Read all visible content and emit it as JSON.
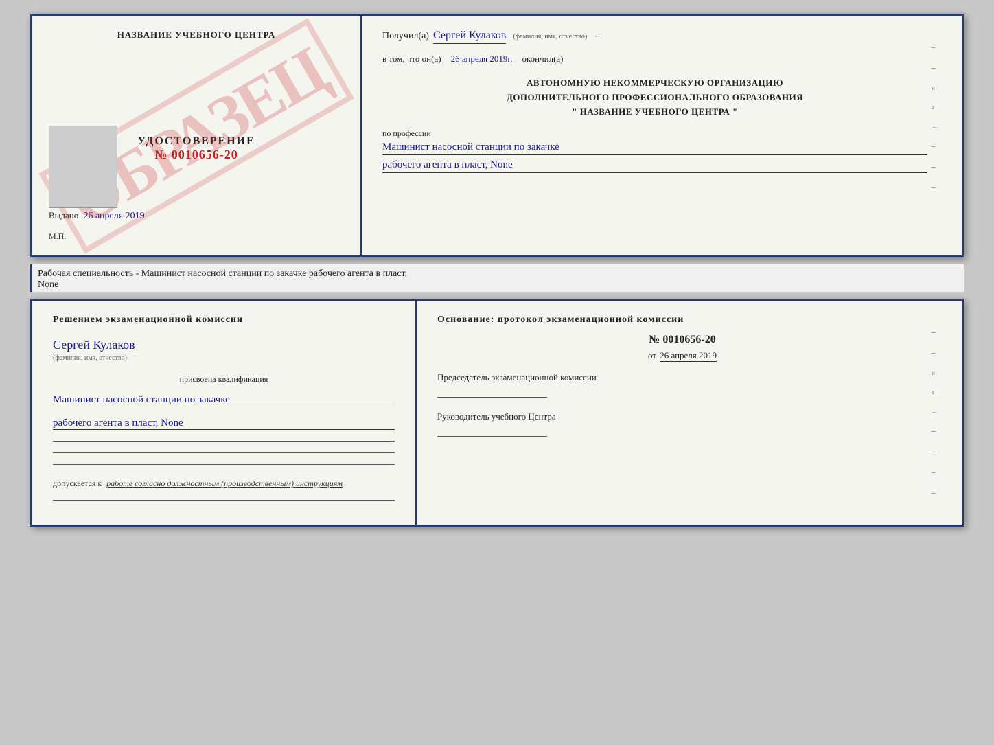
{
  "top_document": {
    "left": {
      "center_title": "НАЗВАНИЕ УЧЕБНОГО ЦЕНТРА",
      "watermark": "ОБРАЗЕЦ",
      "udostoverenie": {
        "label": "УДОСТОВЕРЕНИЕ",
        "number": "№ 0010656-20"
      },
      "vydano": "Выдано",
      "vydano_date": "26 апреля 2019",
      "mp": "М.П."
    },
    "right": {
      "poluchil_label": "Получил(а)",
      "poluchil_name": "Сергей Кулаков",
      "poluchil_sub": "(фамилия, имя, отчество)",
      "dash": "–",
      "vtom_label": "в том, что он(а)",
      "vtom_date": "26 апреля 2019г.",
      "okonchil": "окончил(а)",
      "org_line1": "АВТОНОМНУЮ НЕКОММЕРЧЕСКУЮ ОРГАНИЗАЦИЮ",
      "org_line2": "ДОПОЛНИТЕЛЬНОГО ПРОФЕССИОНАЛЬНОГО ОБРАЗОВАНИЯ",
      "org_line3": "\" НАЗВАНИЕ УЧЕБНОГО ЦЕНТРА \"",
      "po_professii": "по профессии",
      "profession1": "Машинист насосной станции по закачке",
      "profession2": "рабочего агента в пласт, None",
      "side_marks": [
        "и",
        "а",
        "←",
        "–",
        "–",
        "–",
        "–"
      ]
    }
  },
  "subtitle": {
    "line1": "Рабочая специальность - Машинист насосной станции по закачке рабочего агента в пласт,",
    "line2": "None"
  },
  "bottom_document": {
    "left": {
      "resheniyem": "Решением экзаменационной комиссии",
      "name": "Сергей Кулаков",
      "name_sub": "(фамилия, имя, отчество)",
      "prisvoena": "присвоена квалификация",
      "qual1": "Машинист насосной станции по закачке",
      "qual2": "рабочего агента в пласт, None",
      "underlines": [
        "",
        "",
        ""
      ],
      "dopuskaetsya_label": "допускается к",
      "dopuskaetsya_val": "работе согласно должностным (производственным) инструкциям",
      "underline_final": ""
    },
    "right": {
      "osnovanie": "Основание: протокол экзаменационной комиссии",
      "protocol_number": "№ 0010656-20",
      "ot_label": "от",
      "ot_date": "26 апреля 2019",
      "predsedatel_label": "Председатель экзаменационной комиссии",
      "rukovoditel_label": "Руководитель учебного Центра",
      "side_marks": [
        "–",
        "–",
        "и",
        "а",
        "←",
        "–",
        "–",
        "–",
        "–"
      ]
    }
  }
}
